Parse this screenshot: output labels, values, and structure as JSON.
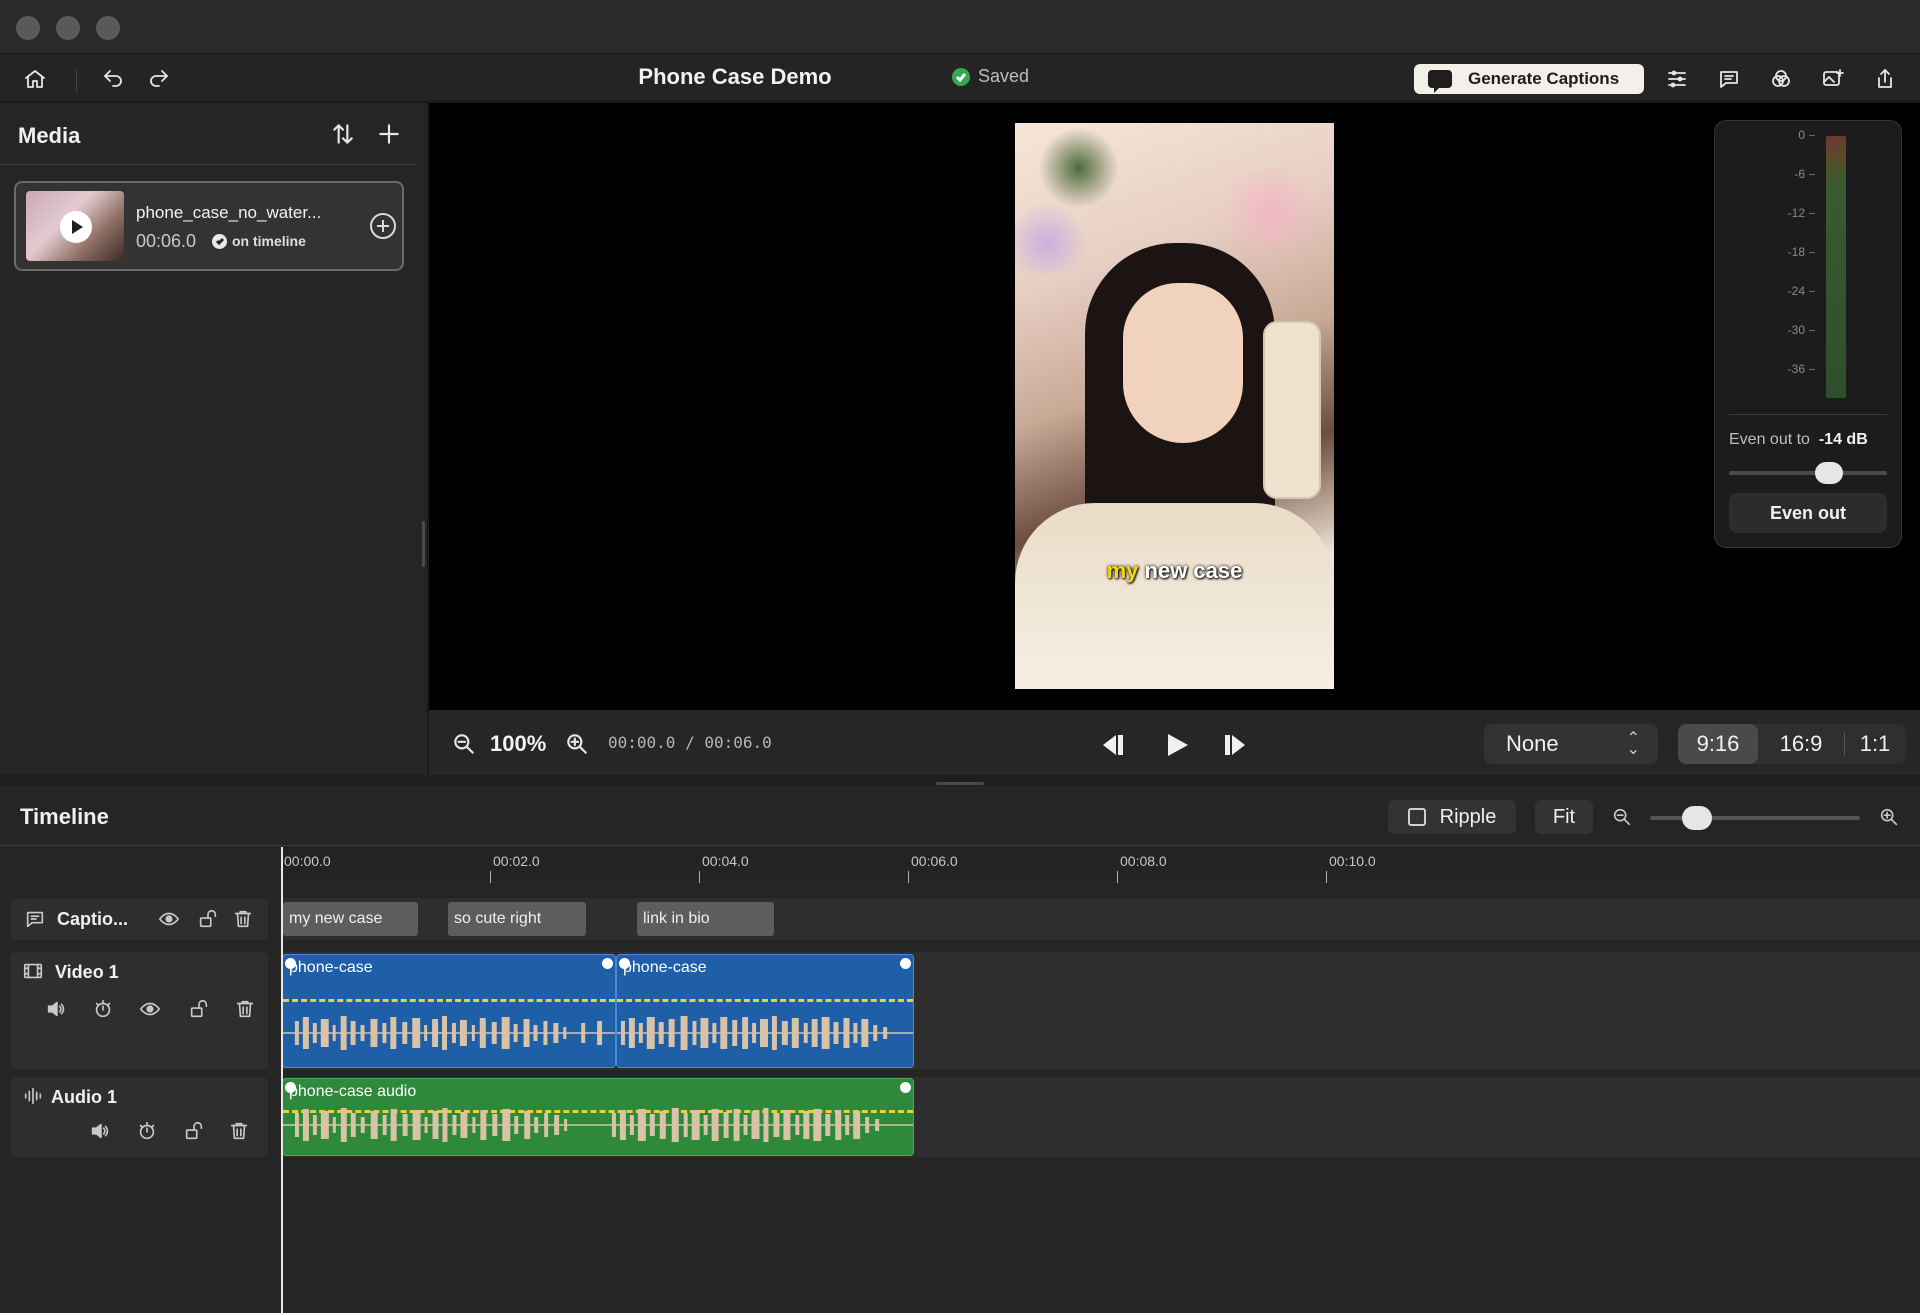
{
  "toolbar": {
    "project_title": "Phone Case Demo",
    "save_status": "Saved",
    "generate_captions_label": "Generate Captions",
    "icons": [
      "home-icon",
      "undo-icon",
      "redo-icon",
      "sliders-icon",
      "comment-icon",
      "color-icon",
      "add-image-icon",
      "share-icon"
    ]
  },
  "media": {
    "title": "Media",
    "items": [
      {
        "name": "phone_case_no_water...",
        "duration": "00:06.0",
        "status": "on timeline"
      }
    ]
  },
  "preview": {
    "caption_highlight": "my",
    "caption_rest": " new case",
    "zoom": "100%",
    "timecode": "00:00.0 / 00:06.0",
    "preset": "None",
    "aspect_ratios": [
      "9:16",
      "16:9",
      "1:1"
    ],
    "active_aspect": "9:16"
  },
  "meter": {
    "ticks": [
      "0",
      "-6",
      "-12",
      "-18",
      "-24",
      "-30",
      "-36"
    ],
    "level_label": "Even out to",
    "level_value": "-14 dB",
    "button_label": "Even out"
  },
  "timeline": {
    "title": "Timeline",
    "ripple_label": "Ripple",
    "fit_label": "Fit",
    "ruler": [
      "00:00.0",
      "00:02.0",
      "00:04.0",
      "00:06.0",
      "00:08.0",
      "00:10.0"
    ],
    "tracks": {
      "captions": {
        "name": "Captio...",
        "clips": [
          "my new case",
          "so cute right",
          "link in bio"
        ]
      },
      "video": {
        "name": "Video 1",
        "clips": [
          "phone-case",
          "phone-case"
        ]
      },
      "audio": {
        "name": "Audio 1",
        "clips": [
          "phone-case audio"
        ]
      }
    }
  }
}
